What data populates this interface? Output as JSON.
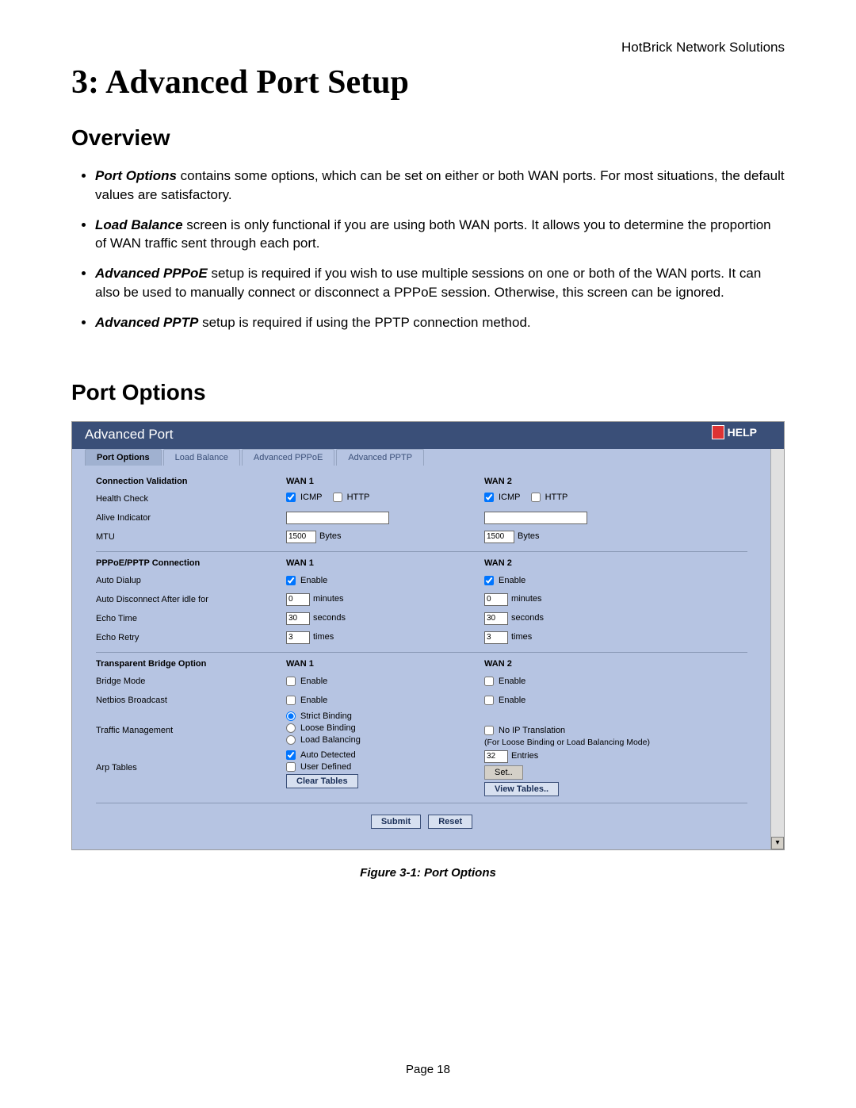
{
  "header_right": "HotBrick Network Solutions",
  "chapter_title": "3: Advanced Port Setup",
  "overview": {
    "title": "Overview",
    "items": [
      {
        "term": "Port Options",
        "rest": " contains some options, which can be set on either or both WAN ports. For most situations, the default values are satisfactory."
      },
      {
        "term": "Load Balance",
        "rest": " screen is only functional if you are using both WAN ports. It allows you to determine the proportion of WAN traffic sent through each port."
      },
      {
        "term": "Advanced PPPoE",
        "rest": " setup is required if you wish to use multiple sessions on one or both of the WAN ports. It can also be used to manually connect or disconnect a PPPoE session. Otherwise, this screen can be ignored."
      },
      {
        "term": "Advanced PPTP",
        "rest": " setup is required if using the PPTP connection method."
      }
    ]
  },
  "port_options_title": "Port Options",
  "panel": {
    "title": "Advanced Port",
    "help": "HELP",
    "tabs": [
      "Port Options",
      "Load Balance",
      "Advanced PPPoE",
      "Advanced PPTP"
    ],
    "active_tab": 0,
    "columns": {
      "wan1": "WAN 1",
      "wan2": "WAN 2"
    },
    "sections": {
      "conn_valid": {
        "title": "Connection Validation",
        "health_label": "Health Check",
        "health": {
          "icmp_label": "ICMP",
          "http_label": "HTTP",
          "wan1": {
            "icmp": true,
            "http": false
          },
          "wan2": {
            "icmp": true,
            "http": false
          }
        },
        "alive_label": "Alive Indicator",
        "alive": {
          "wan1": "",
          "wan2": ""
        },
        "mtu_label": "MTU",
        "mtu": {
          "wan1": "1500",
          "wan2": "1500",
          "unit": "Bytes"
        }
      },
      "pppoe": {
        "title": "PPPoE/PPTP Connection",
        "auto_dialup_label": "Auto Dialup",
        "enable_label": "Enable",
        "auto_dialup": {
          "wan1": true,
          "wan2": true
        },
        "auto_disc_label": "Auto Disconnect After idle for",
        "auto_disc": {
          "wan1": "0",
          "wan2": "0",
          "unit": "minutes"
        },
        "echo_time_label": "Echo Time",
        "echo_time": {
          "wan1": "30",
          "wan2": "30",
          "unit": "seconds"
        },
        "echo_retry_label": "Echo Retry",
        "echo_retry": {
          "wan1": "3",
          "wan2": "3",
          "unit": "times"
        }
      },
      "bridge": {
        "title": "Transparent Bridge Option",
        "bridge_mode_label": "Bridge Mode",
        "enable_label": "Enable",
        "bridge_mode": {
          "wan1": false,
          "wan2": false
        },
        "netbios_label": "Netbios Broadcast",
        "netbios": {
          "wan1": false,
          "wan2": false
        },
        "traffic_label": "Traffic Management",
        "traffic_opts": {
          "strict": "Strict Binding",
          "loose": "Loose Binding",
          "load": "Load Balancing",
          "selected": "strict"
        },
        "noip_label": "No IP Translation",
        "noip_checked": false,
        "noip_note": "(For Loose Binding or Load Balancing Mode)",
        "arp_label": "Arp Tables",
        "arp_opts": {
          "auto": "Auto Detected",
          "user": "User Defined",
          "auto_checked": true,
          "user_checked": false
        },
        "entries_value": "32",
        "entries_unit": "Entries",
        "set_btn": "Set..",
        "clear_btn": "Clear Tables",
        "view_btn": "View Tables.."
      }
    },
    "submit": "Submit",
    "reset": "Reset"
  },
  "figure_caption": "Figure 3-1: Port Options",
  "page_number": "Page 18"
}
